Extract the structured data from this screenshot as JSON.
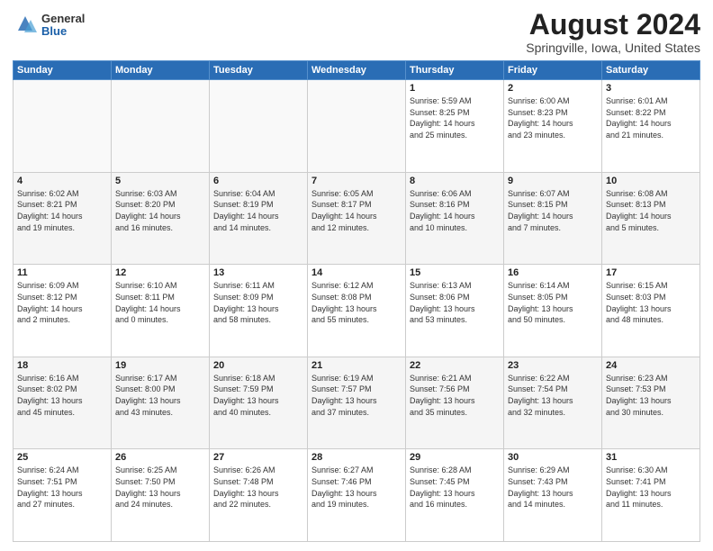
{
  "logo": {
    "general": "General",
    "blue": "Blue"
  },
  "title": "August 2024",
  "subtitle": "Springville, Iowa, United States",
  "weekdays": [
    "Sunday",
    "Monday",
    "Tuesday",
    "Wednesday",
    "Thursday",
    "Friday",
    "Saturday"
  ],
  "weeks": [
    [
      {
        "day": "",
        "info": ""
      },
      {
        "day": "",
        "info": ""
      },
      {
        "day": "",
        "info": ""
      },
      {
        "day": "",
        "info": ""
      },
      {
        "day": "1",
        "info": "Sunrise: 5:59 AM\nSunset: 8:25 PM\nDaylight: 14 hours\nand 25 minutes."
      },
      {
        "day": "2",
        "info": "Sunrise: 6:00 AM\nSunset: 8:23 PM\nDaylight: 14 hours\nand 23 minutes."
      },
      {
        "day": "3",
        "info": "Sunrise: 6:01 AM\nSunset: 8:22 PM\nDaylight: 14 hours\nand 21 minutes."
      }
    ],
    [
      {
        "day": "4",
        "info": "Sunrise: 6:02 AM\nSunset: 8:21 PM\nDaylight: 14 hours\nand 19 minutes."
      },
      {
        "day": "5",
        "info": "Sunrise: 6:03 AM\nSunset: 8:20 PM\nDaylight: 14 hours\nand 16 minutes."
      },
      {
        "day": "6",
        "info": "Sunrise: 6:04 AM\nSunset: 8:19 PM\nDaylight: 14 hours\nand 14 minutes."
      },
      {
        "day": "7",
        "info": "Sunrise: 6:05 AM\nSunset: 8:17 PM\nDaylight: 14 hours\nand 12 minutes."
      },
      {
        "day": "8",
        "info": "Sunrise: 6:06 AM\nSunset: 8:16 PM\nDaylight: 14 hours\nand 10 minutes."
      },
      {
        "day": "9",
        "info": "Sunrise: 6:07 AM\nSunset: 8:15 PM\nDaylight: 14 hours\nand 7 minutes."
      },
      {
        "day": "10",
        "info": "Sunrise: 6:08 AM\nSunset: 8:13 PM\nDaylight: 14 hours\nand 5 minutes."
      }
    ],
    [
      {
        "day": "11",
        "info": "Sunrise: 6:09 AM\nSunset: 8:12 PM\nDaylight: 14 hours\nand 2 minutes."
      },
      {
        "day": "12",
        "info": "Sunrise: 6:10 AM\nSunset: 8:11 PM\nDaylight: 14 hours\nand 0 minutes."
      },
      {
        "day": "13",
        "info": "Sunrise: 6:11 AM\nSunset: 8:09 PM\nDaylight: 13 hours\nand 58 minutes."
      },
      {
        "day": "14",
        "info": "Sunrise: 6:12 AM\nSunset: 8:08 PM\nDaylight: 13 hours\nand 55 minutes."
      },
      {
        "day": "15",
        "info": "Sunrise: 6:13 AM\nSunset: 8:06 PM\nDaylight: 13 hours\nand 53 minutes."
      },
      {
        "day": "16",
        "info": "Sunrise: 6:14 AM\nSunset: 8:05 PM\nDaylight: 13 hours\nand 50 minutes."
      },
      {
        "day": "17",
        "info": "Sunrise: 6:15 AM\nSunset: 8:03 PM\nDaylight: 13 hours\nand 48 minutes."
      }
    ],
    [
      {
        "day": "18",
        "info": "Sunrise: 6:16 AM\nSunset: 8:02 PM\nDaylight: 13 hours\nand 45 minutes."
      },
      {
        "day": "19",
        "info": "Sunrise: 6:17 AM\nSunset: 8:00 PM\nDaylight: 13 hours\nand 43 minutes."
      },
      {
        "day": "20",
        "info": "Sunrise: 6:18 AM\nSunset: 7:59 PM\nDaylight: 13 hours\nand 40 minutes."
      },
      {
        "day": "21",
        "info": "Sunrise: 6:19 AM\nSunset: 7:57 PM\nDaylight: 13 hours\nand 37 minutes."
      },
      {
        "day": "22",
        "info": "Sunrise: 6:21 AM\nSunset: 7:56 PM\nDaylight: 13 hours\nand 35 minutes."
      },
      {
        "day": "23",
        "info": "Sunrise: 6:22 AM\nSunset: 7:54 PM\nDaylight: 13 hours\nand 32 minutes."
      },
      {
        "day": "24",
        "info": "Sunrise: 6:23 AM\nSunset: 7:53 PM\nDaylight: 13 hours\nand 30 minutes."
      }
    ],
    [
      {
        "day": "25",
        "info": "Sunrise: 6:24 AM\nSunset: 7:51 PM\nDaylight: 13 hours\nand 27 minutes."
      },
      {
        "day": "26",
        "info": "Sunrise: 6:25 AM\nSunset: 7:50 PM\nDaylight: 13 hours\nand 24 minutes."
      },
      {
        "day": "27",
        "info": "Sunrise: 6:26 AM\nSunset: 7:48 PM\nDaylight: 13 hours\nand 22 minutes."
      },
      {
        "day": "28",
        "info": "Sunrise: 6:27 AM\nSunset: 7:46 PM\nDaylight: 13 hours\nand 19 minutes."
      },
      {
        "day": "29",
        "info": "Sunrise: 6:28 AM\nSunset: 7:45 PM\nDaylight: 13 hours\nand 16 minutes."
      },
      {
        "day": "30",
        "info": "Sunrise: 6:29 AM\nSunset: 7:43 PM\nDaylight: 13 hours\nand 14 minutes."
      },
      {
        "day": "31",
        "info": "Sunrise: 6:30 AM\nSunset: 7:41 PM\nDaylight: 13 hours\nand 11 minutes."
      }
    ]
  ]
}
